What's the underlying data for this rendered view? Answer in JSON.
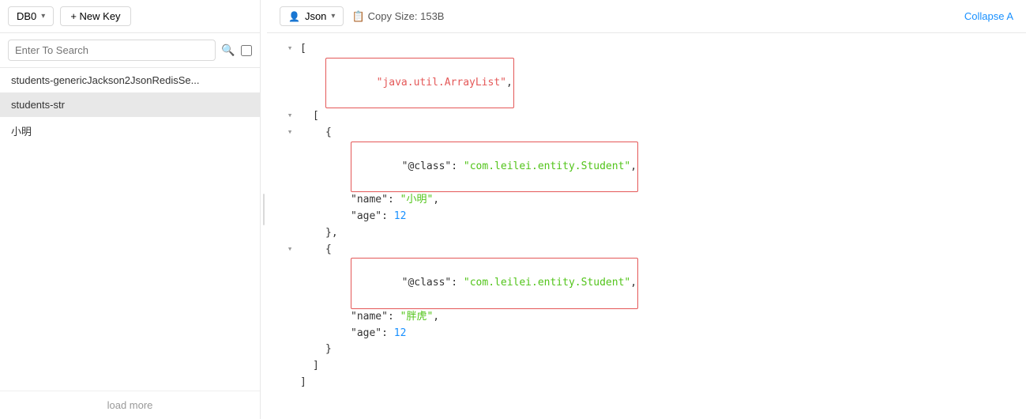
{
  "sidebar": {
    "db_label": "DB0",
    "new_key_label": "+ New Key",
    "search_placeholder": "Enter To Search",
    "keys": [
      {
        "id": "key-1",
        "label": "students-genericJackson2JsonRedisSe...",
        "active": false
      },
      {
        "id": "key-2",
        "label": "students-str",
        "active": true
      },
      {
        "id": "key-3",
        "label": "小明",
        "active": false
      }
    ],
    "load_more_label": "load more"
  },
  "toolbar": {
    "format_icon": "👤",
    "format_label": "Json",
    "copy_label": "Copy Size: 153B",
    "collapse_label": "Collapse A"
  },
  "json": {
    "collapse_label": "Collapse A"
  }
}
